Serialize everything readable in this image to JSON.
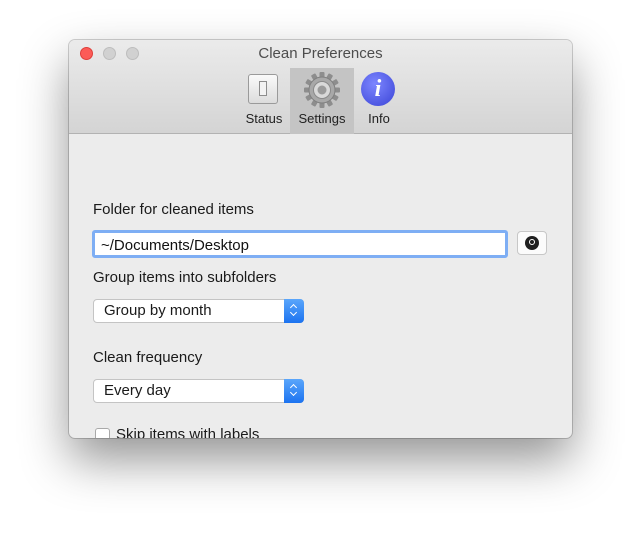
{
  "window": {
    "title": "Clean Preferences"
  },
  "toolbar": {
    "items": [
      {
        "label": "Status",
        "icon": "switch-icon",
        "selected": false
      },
      {
        "label": "Settings",
        "icon": "gear-icon",
        "selected": true
      },
      {
        "label": "Info",
        "icon": "info-icon",
        "selected": false
      }
    ]
  },
  "settings": {
    "folder_label": "Folder for cleaned items",
    "folder_value": "~/Documents/Desktop",
    "group_label": "Group items into subfolders",
    "group_value": "Group by month",
    "frequency_label": "Clean frequency",
    "frequency_value": "Every day",
    "skip_label": "Skip items with labels",
    "skip_checked": false
  },
  "colors": {
    "accent": "#1c73f0",
    "focus_ring": "#7eaef4",
    "info_icon": "#3a44d6",
    "close_button": "#fc5b57"
  }
}
